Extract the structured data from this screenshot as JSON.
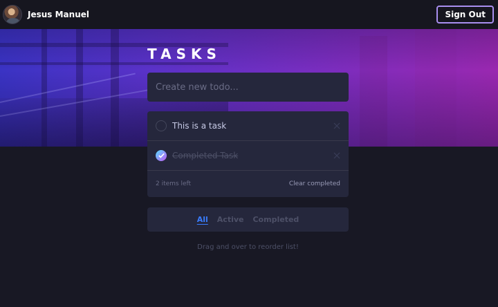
{
  "header": {
    "user_name": "Jesus Manuel",
    "sign_out_label": "Sign Out"
  },
  "main": {
    "title": "TASKS",
    "new_todo_placeholder": "Create new todo...",
    "todos": [
      {
        "text": "This is a task",
        "completed": false
      },
      {
        "text": "Completed Task",
        "completed": true
      }
    ],
    "items_left": "2 items left",
    "clear_completed_label": "Clear completed",
    "filters": [
      {
        "label": "All",
        "active": true
      },
      {
        "label": "Active",
        "active": false
      },
      {
        "label": "Completed",
        "active": false
      }
    ],
    "hint": "Drag and over to reorder list!"
  },
  "colors": {
    "background": "#181824",
    "card": "#25273c",
    "accent_blue": "#3a7cfd",
    "check_gradient_start": "#57ddff",
    "check_gradient_end": "#c058f3",
    "sign_out_border": "#a98ff0"
  },
  "icons": {
    "avatar": "user-photo",
    "check": "check-icon",
    "delete": "cross-icon"
  }
}
